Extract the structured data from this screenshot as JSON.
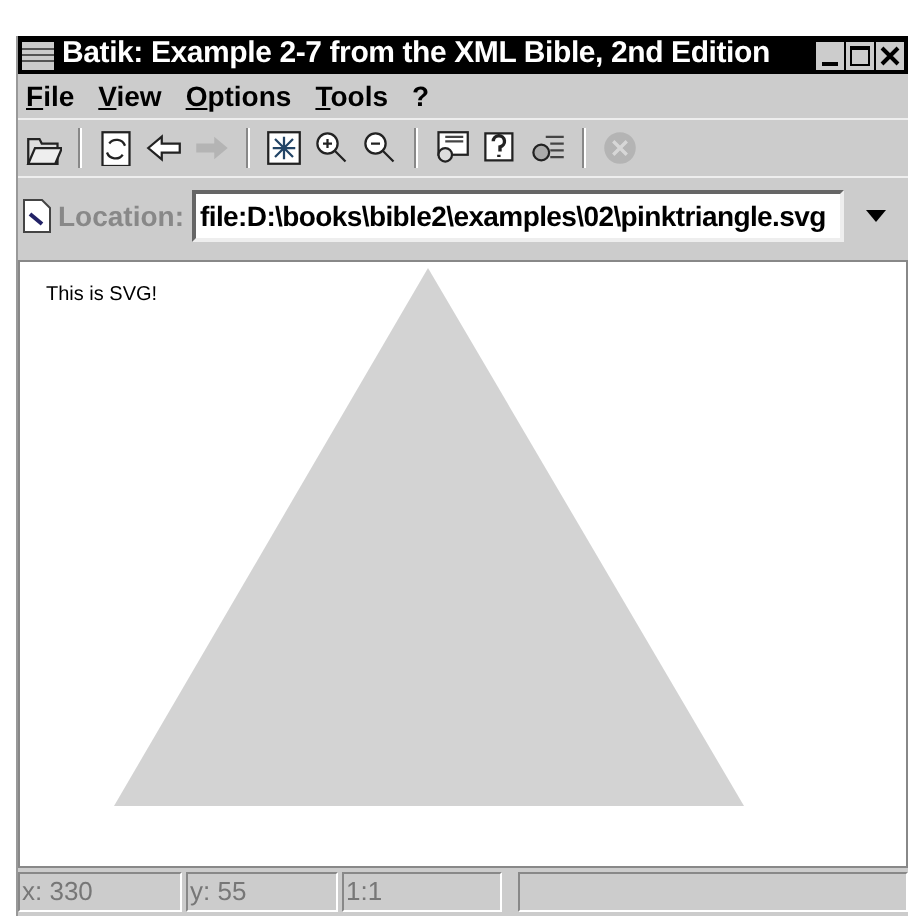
{
  "window": {
    "title": "Batik: Example 2-7 from the XML Bible, 2nd Edition"
  },
  "menu": [
    {
      "label": "File"
    },
    {
      "label": "View"
    },
    {
      "label": "Options"
    },
    {
      "label": "Tools"
    },
    {
      "label": "?"
    }
  ],
  "toolbar": [
    {
      "kind": "open",
      "disabled": false
    },
    {
      "kind": "separator"
    },
    {
      "kind": "reload",
      "disabled": false
    },
    {
      "kind": "back",
      "disabled": false
    },
    {
      "kind": "forward",
      "disabled": true
    },
    {
      "kind": "separator"
    },
    {
      "kind": "fit",
      "disabled": false
    },
    {
      "kind": "zoom-in",
      "disabled": false
    },
    {
      "kind": "zoom-out",
      "disabled": false
    },
    {
      "kind": "separator"
    },
    {
      "kind": "viewer",
      "disabled": false
    },
    {
      "kind": "help",
      "disabled": false
    },
    {
      "kind": "tree",
      "disabled": false
    },
    {
      "kind": "separator"
    },
    {
      "kind": "stop",
      "disabled": true
    }
  ],
  "location": {
    "label": "Location:",
    "value": "file:D:\\books\\bible2\\examples\\02\\pinktriangle.svg"
  },
  "canvas": {
    "text": "This is SVG!"
  },
  "status_bar": [
    "x: 330",
    "y: 55",
    "1:1"
  ]
}
